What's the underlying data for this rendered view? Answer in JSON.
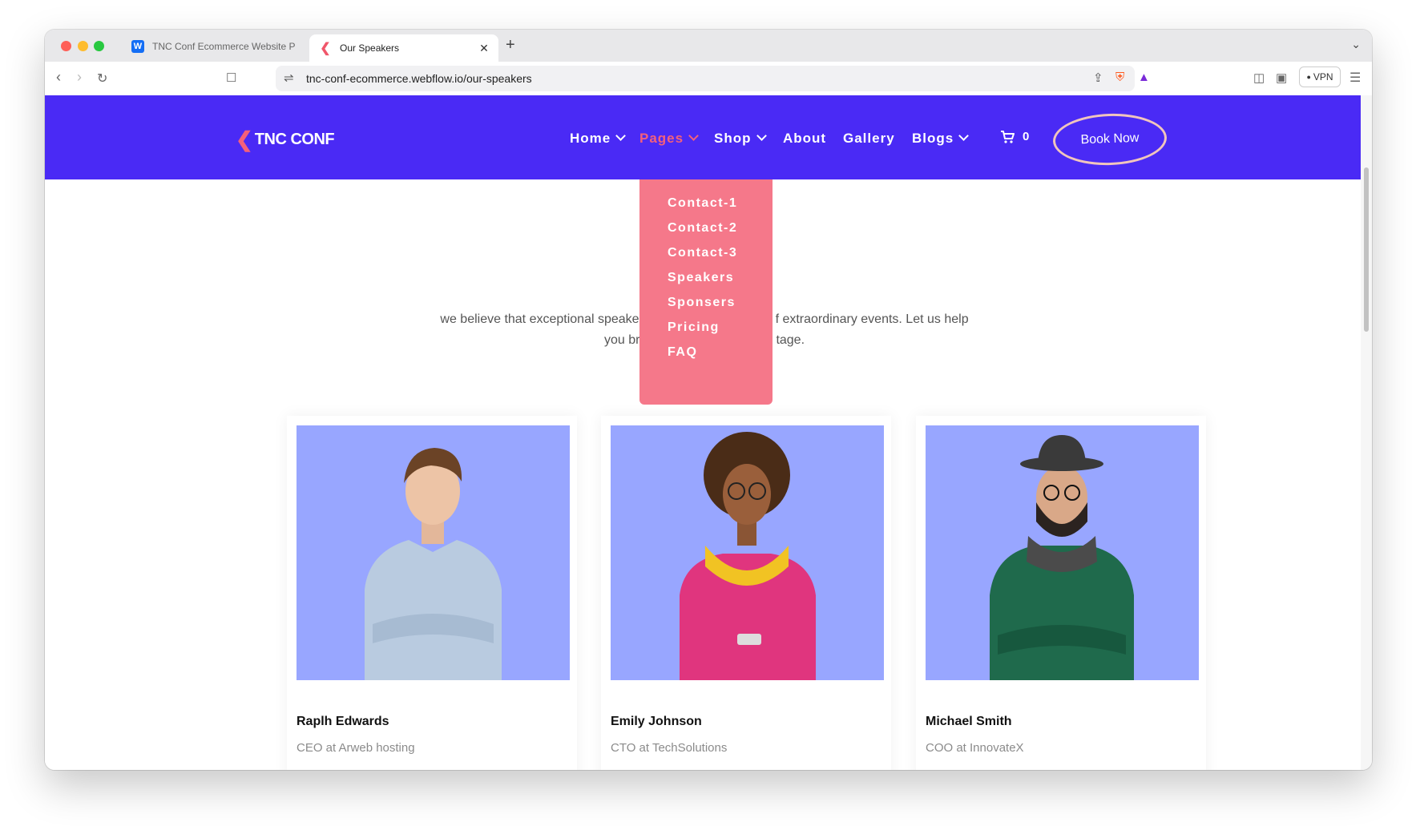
{
  "browser": {
    "tabs": [
      {
        "label": "TNC Conf Ecommerce Website P"
      },
      {
        "label": "Our Speakers"
      }
    ],
    "url": "tnc-conf-ecommerce.webflow.io/our-speakers",
    "vpn_label": "VPN"
  },
  "site": {
    "logo_text": "TNC CONF",
    "nav": {
      "home": "Home",
      "pages": "Pages",
      "shop": "Shop",
      "about": "About",
      "gallery": "Gallery",
      "blogs": "Blogs",
      "cart_count": "0",
      "book_now": "Book Now"
    },
    "dropdown": [
      "Contact-1",
      "Contact-2",
      "Contact-3",
      "Speakers",
      "Sponsers",
      "Pricing",
      "FAQ"
    ],
    "intro": {
      "line1_left": "we believe that exceptional speake",
      "line1_right": "f extraordinary events. Let us help",
      "line2_left": "you br",
      "line2_right": "tage."
    },
    "speakers": [
      {
        "name": "Raplh Edwards",
        "role": "CEO at Arweb hosting"
      },
      {
        "name": "Emily Johnson",
        "role": "CTO at TechSolutions"
      },
      {
        "name": "Michael Smith",
        "role": "COO at InnovateX"
      }
    ]
  },
  "colors": {
    "nav_bg": "#4a2af5",
    "accent": "#f4607a",
    "dropdown_bg": "#f5788a",
    "card_image_bg": "#98a6ff"
  }
}
